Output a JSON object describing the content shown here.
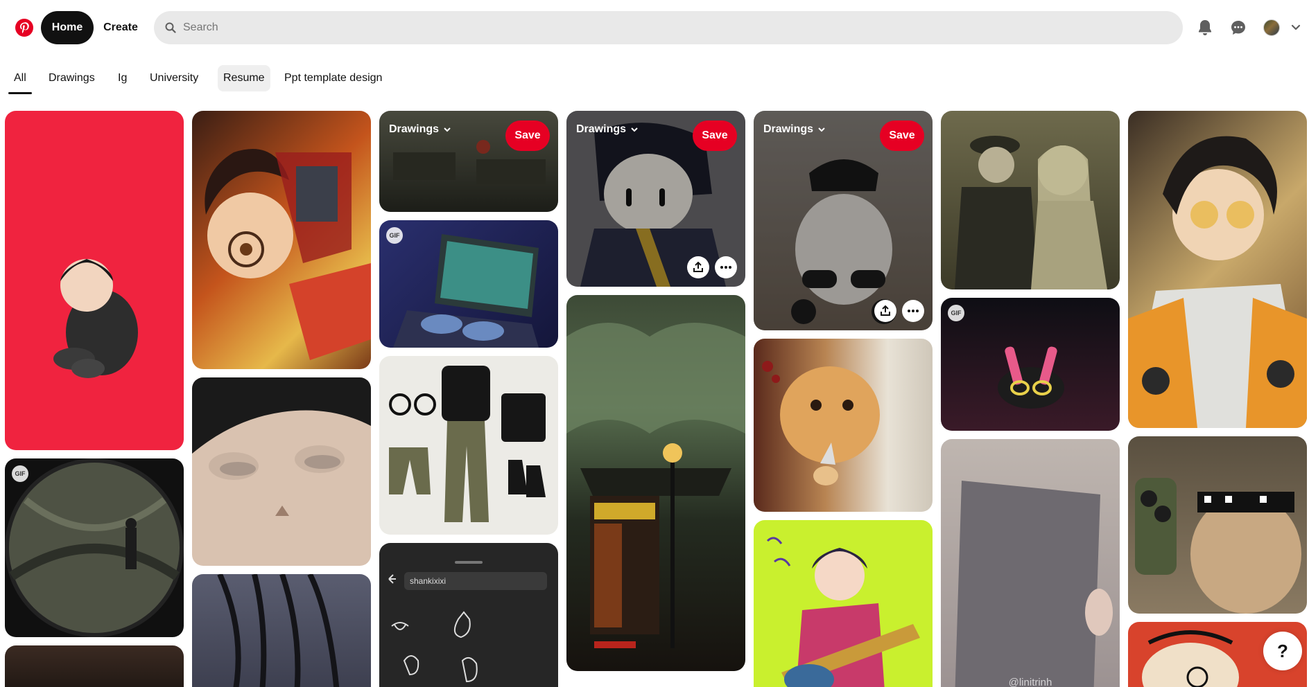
{
  "header": {
    "home_label": "Home",
    "create_label": "Create",
    "search_placeholder": "Search"
  },
  "tabs": [
    {
      "label": "All"
    },
    {
      "label": "Drawings"
    },
    {
      "label": "Ig"
    },
    {
      "label": "University"
    },
    {
      "label": "Resume"
    },
    {
      "label": "Ppt template design"
    }
  ],
  "pins": {
    "gif_label": "GIF",
    "board_label": "Drawings",
    "save_label": "Save",
    "watermark": "@linitrinh",
    "search_text": "shankixixi"
  },
  "help_label": "?",
  "colors": {
    "brand": "#e60023",
    "home_bg": "#111111",
    "search_bg": "#e9e9e9"
  },
  "icons": [
    "pinterest-logo-icon",
    "search-icon",
    "bell-icon",
    "chat-icon",
    "chevron-down-icon",
    "share-icon",
    "more-icon"
  ]
}
